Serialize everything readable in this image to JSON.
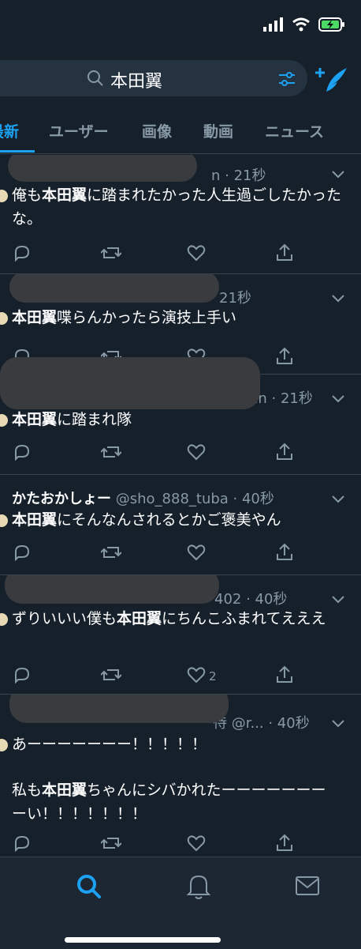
{
  "search": {
    "query": "本田翼"
  },
  "tabs": [
    {
      "label": "最新"
    },
    {
      "label": "ユーザー"
    },
    {
      "label": "画像"
    },
    {
      "label": "動画"
    },
    {
      "label": "ニュース"
    }
  ],
  "tweets": [
    {
      "meta": "n · 21秒",
      "pre": "俺も",
      "kw": "本田翼",
      "post": "に踏まれたかった人生過ごしたかったな。",
      "likes": ""
    },
    {
      "meta": "21秒",
      "pre": "",
      "kw": "本田翼",
      "post": "喋らんかったら演技上手い",
      "likes": ""
    },
    {
      "meta": "nn · 21秒",
      "pre": "",
      "kw": "本田翼",
      "post": "に踏まれ隊",
      "likes": ""
    },
    {
      "name": "かたおかしょー",
      "handle": "@sho_888_tuba · 40秒",
      "pre": "",
      "kw": "本田翼",
      "post": "にそんなんされるとかご褒美やん",
      "likes": ""
    },
    {
      "meta": "402 · 40秒",
      "pre": "ずりいいい僕も",
      "kw": "本田翼",
      "post": "にちんこふまれてえええ",
      "likes": "2"
    },
    {
      "meta": "待 @r... · 40秒",
      "line1": "あーーーーーーー！！！！！",
      "pre": "私も",
      "kw": "本田翼",
      "post": "ちゃんにシバかれたーーーーーーーーい！！！！！！！",
      "likes": ""
    }
  ],
  "colors": {
    "background": "#15202b",
    "accent": "#1da1f2",
    "muted": "#8899a6",
    "divider": "#38444d"
  }
}
